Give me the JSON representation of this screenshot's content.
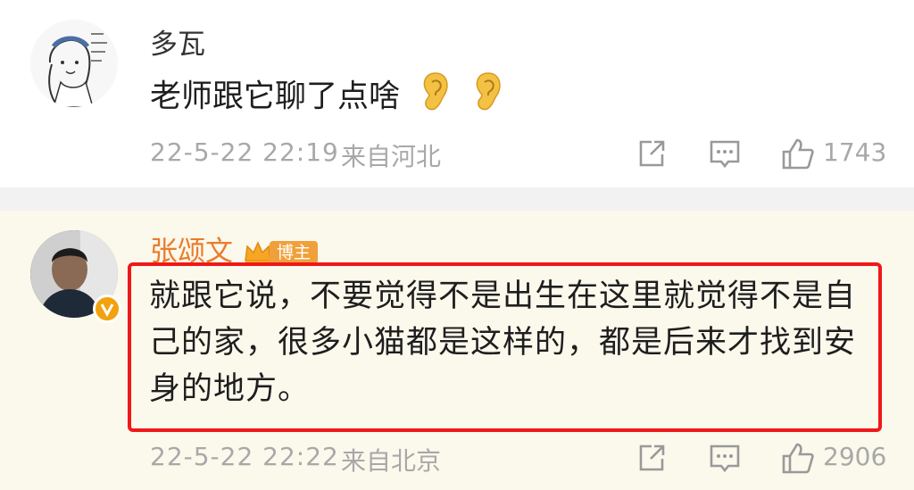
{
  "comments": [
    {
      "username": "多瓦",
      "text": "老师跟它聊了点啥",
      "emoji_icons": [
        "ear-emoji-icon",
        "ear-emoji-icon"
      ],
      "timestamp": "22-5-22 22:19",
      "location": "来自河北",
      "likes": "1743",
      "avatar_icon": "illustrated-girl-avatar"
    },
    {
      "username": "张颂文",
      "badge": "博主",
      "text": "就跟它说，不要觉得不是出生在这里就觉得不是自己的家，很多小猫都是这样的，都是后来才找到安身的地方。",
      "timestamp": "22-5-22 22:22",
      "location": "来自北京",
      "likes": "2906",
      "avatar_icon": "man-photo-avatar",
      "highlighted": true
    }
  ],
  "colors": {
    "blogger_name": "#eb7b2a",
    "badge_bg": "#f0a03a",
    "highlight_border": "#f01818",
    "meta_text": "#a8a8a8",
    "highlight_bg": "#fbf8ec"
  }
}
